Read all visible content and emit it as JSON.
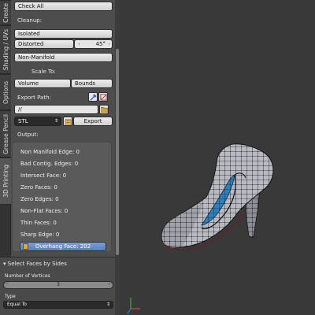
{
  "tabs": [
    {
      "label": "Create",
      "active": false
    },
    {
      "label": "Shading / UVs",
      "active": false
    },
    {
      "label": "Options",
      "active": false
    },
    {
      "label": "Grease Pencil",
      "active": false
    },
    {
      "label": "3D Printing",
      "active": true
    }
  ],
  "panel": {
    "check_all": "Check All",
    "cleanup_label": "Cleanup:",
    "isolated": "Isolated",
    "distorted": "Distorted",
    "distorted_angle": "45°",
    "non_manifold": "Non-Manifold",
    "scale_to_label": "Scale To:",
    "volume": "Volume",
    "bounds": "Bounds",
    "export_path_label": "Export Path:",
    "export_path_value": "//",
    "format_value": "STL",
    "export_button": "Export",
    "output_label": "Output:",
    "output_lines": [
      "Non Manifold Edge: 0",
      "Bad Contig. Edges: 0",
      "Intersect Face: 0",
      "Zero Faces: 0",
      "Zero Edges: 0",
      "Non-Flat Faces: 0",
      "Thin Faces: 0",
      "Sharp Edge: 0"
    ],
    "overhang_button": "Overhang Face: 202"
  },
  "redo": {
    "title": "Select Faces by Sides",
    "vertices_label": "Number of Vertices",
    "vertices_value": "3",
    "type_label": "Type",
    "type_value": "Equal To"
  },
  "colors": {
    "panel_bg": "#4d4d4d",
    "viewport_bg": "#393939",
    "button": "#d9d9d9",
    "selected_blue": "#5680c2",
    "face_highlight": "#2f7fb8"
  },
  "icons": {
    "eyedropper": "eyedropper-icon",
    "flip": "flip-icon",
    "folder": "folder-icon",
    "export_file": "export-file-icon"
  }
}
